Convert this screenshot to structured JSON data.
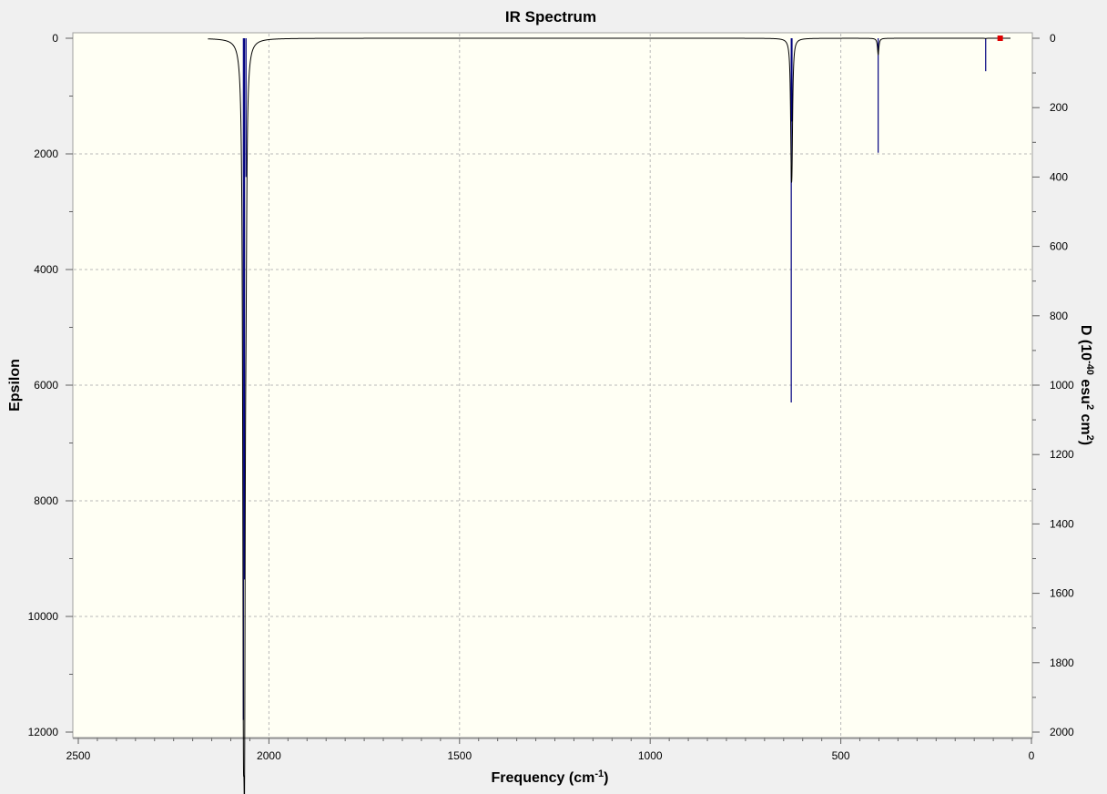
{
  "chart_data": {
    "type": "line",
    "title": "IR Spectrum",
    "xlabel": {
      "base": "Frequency (cm",
      "sup": "-1",
      "close": ")"
    },
    "ylabel_left": "Epsilon",
    "ylabel_right": {
      "part1": "D (10",
      "sup1": "-40",
      "part2": " esu",
      "sup2": "2",
      "part3": " cm",
      "sup3": "2",
      "part4": ")"
    },
    "x_axis": {
      "range": [
        2500,
        0
      ],
      "reversed": true,
      "ticks": [
        2500,
        2000,
        1500,
        1000,
        500,
        0
      ],
      "tick_labels": [
        "2500",
        "2000",
        "1500",
        "1000",
        "500",
        "0"
      ]
    },
    "y_left": {
      "range": [
        0,
        12000
      ],
      "inverted": true,
      "ticks": [
        0,
        2000,
        4000,
        6000,
        8000,
        10000,
        12000
      ],
      "tick_labels": [
        "0",
        "2000",
        "4000",
        "6000",
        "8000",
        "10000",
        "12000"
      ]
    },
    "y_right": {
      "range": [
        0,
        2000
      ],
      "inverted": true,
      "ticks": [
        0,
        200,
        400,
        600,
        800,
        1000,
        1200,
        1400,
        1600,
        1800,
        2000
      ],
      "tick_labels": [
        "0",
        "200",
        "400",
        "600",
        "800",
        "1000",
        "1200",
        "1400",
        "1600",
        "1800",
        "2000"
      ]
    },
    "grid": true,
    "spectrum_range": [
      2160,
      55
    ],
    "peaks": [
      {
        "frequency": 2067,
        "epsilon": 8800,
        "D": 1965
      },
      {
        "frequency": 2064,
        "epsilon": 9500,
        "D": 1560
      },
      {
        "frequency": 2060,
        "epsilon": 2200,
        "D": 400
      },
      {
        "frequency": 630,
        "epsilon": 1550,
        "D": 1050
      },
      {
        "frequency": 628,
        "epsilon": 1450,
        "D": 240
      },
      {
        "frequency": 402,
        "epsilon": 280,
        "D": 330
      },
      {
        "frequency": 120,
        "epsilon": 5,
        "D": 95
      },
      {
        "frequency": 82,
        "epsilon": 5,
        "D": 8
      }
    ],
    "colors": {
      "background": "#f0f0f0",
      "plot_area": "#fffff4",
      "spectrum_line": "#000000",
      "stick_lines": "#00007f",
      "grid": "#b8b8b8",
      "marker": "#e00000"
    }
  }
}
